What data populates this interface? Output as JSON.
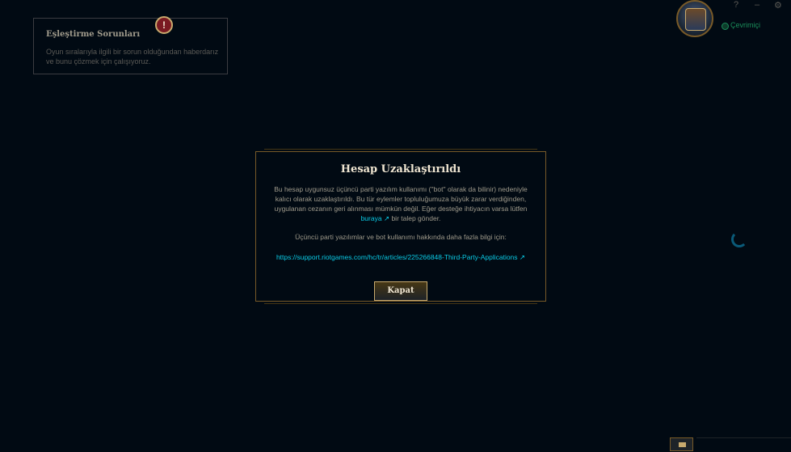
{
  "notification": {
    "alert_glyph": "!",
    "title": "Eşleştirme Sorunları",
    "body": "Oyun sıralarıyla ilgili bir sorun olduğundan haberdarız ve bunu çözmek için çalışıyoruz."
  },
  "header": {
    "status_text": "Çevrimiçi",
    "help_glyph": "?",
    "minimize_glyph": "–",
    "settings_glyph": "⚙"
  },
  "modal": {
    "title": "Hesap Uzaklaştırıldı",
    "body_part1": "Bu hesap uygunsuz üçüncü parti yazılım kullanımı (''bot'' olarak da bilinir) nedeniyle kalıcı olarak uzaklaştırıldı. Bu tür eylemler topluluğumuza büyük zarar verdiğinden, uygulanan cezanın geri alınması mümkün değil. Eğer desteğe ihtiyacın varsa lütfen",
    "link_text": "buraya",
    "link_arrow": "↗",
    "body_part2": "bir talep gönder.",
    "more_info": "Üçüncü parti yazılımlar ve bot kullanımı hakkında daha fazla bilgi için:",
    "url": "https://support.riotgames.com/hc/tr/articles/225266848-Third-Party-Applications",
    "url_arrow": "↗",
    "close_label": "Kapat"
  },
  "colors": {
    "background": "#010a13",
    "gold_border": "#785a28",
    "link": "#0acbe6",
    "online": "#1b8e5b"
  }
}
